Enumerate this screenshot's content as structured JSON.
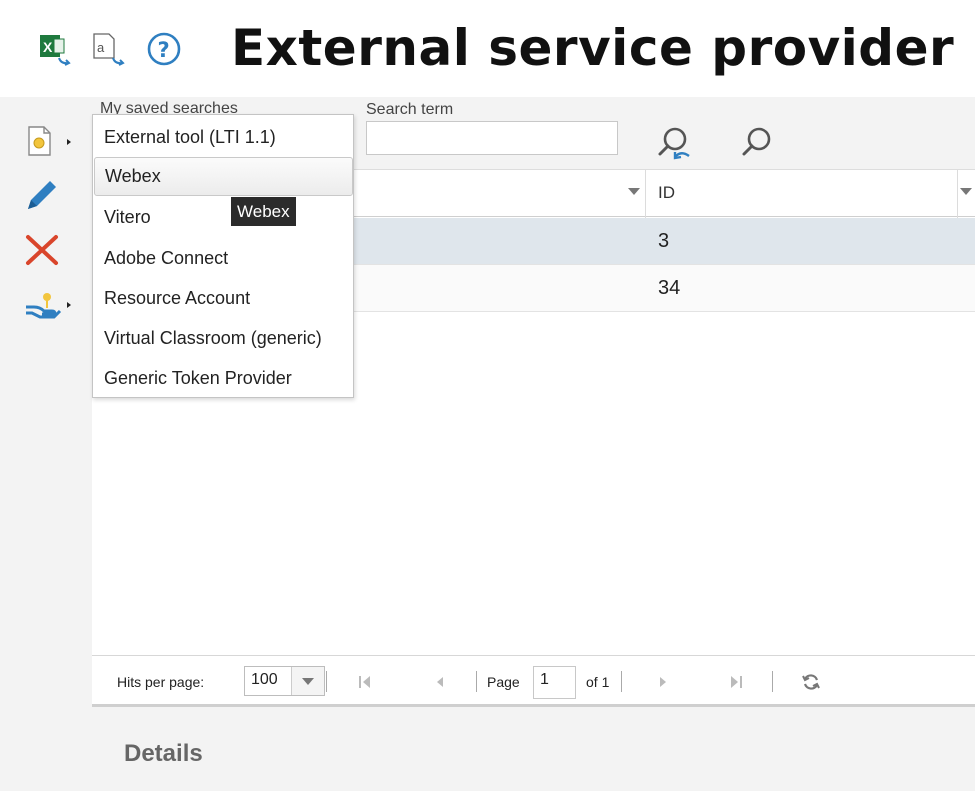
{
  "header": {
    "title": "External service provider",
    "icons": [
      "excel-export-icon",
      "text-export-icon",
      "help-icon"
    ]
  },
  "toolbar": {
    "icons": [
      "new-document-icon",
      "edit-pencil-icon",
      "delete-x-icon",
      "key-hand-icon"
    ]
  },
  "filters": {
    "saved_searches_label": "My saved searches",
    "search_term_label": "Search term",
    "search_term_value": ""
  },
  "grid": {
    "columns": [
      "",
      "ID"
    ],
    "rows": [
      {
        "id": "3"
      },
      {
        "id": "34"
      }
    ]
  },
  "menu": {
    "items": [
      "External tool (LTI 1.1)",
      "Webex",
      "Vitero",
      "Adobe Connect",
      "Resource Account",
      "Virtual Classroom (generic)",
      "Generic Token Provider"
    ],
    "hovered_index": 1,
    "tooltip": "Webex"
  },
  "pager": {
    "hits_label": "Hits per page:",
    "hits_value": "100",
    "page_label": "Page",
    "page_value": "1",
    "of_label": "of 1"
  },
  "details": {
    "title": "Details"
  },
  "colors": {
    "selected_row": "#dfe6ec",
    "accent_blue": "#2f7fc1",
    "delete_red": "#d9452b",
    "excel_green": "#1f7a3e"
  }
}
